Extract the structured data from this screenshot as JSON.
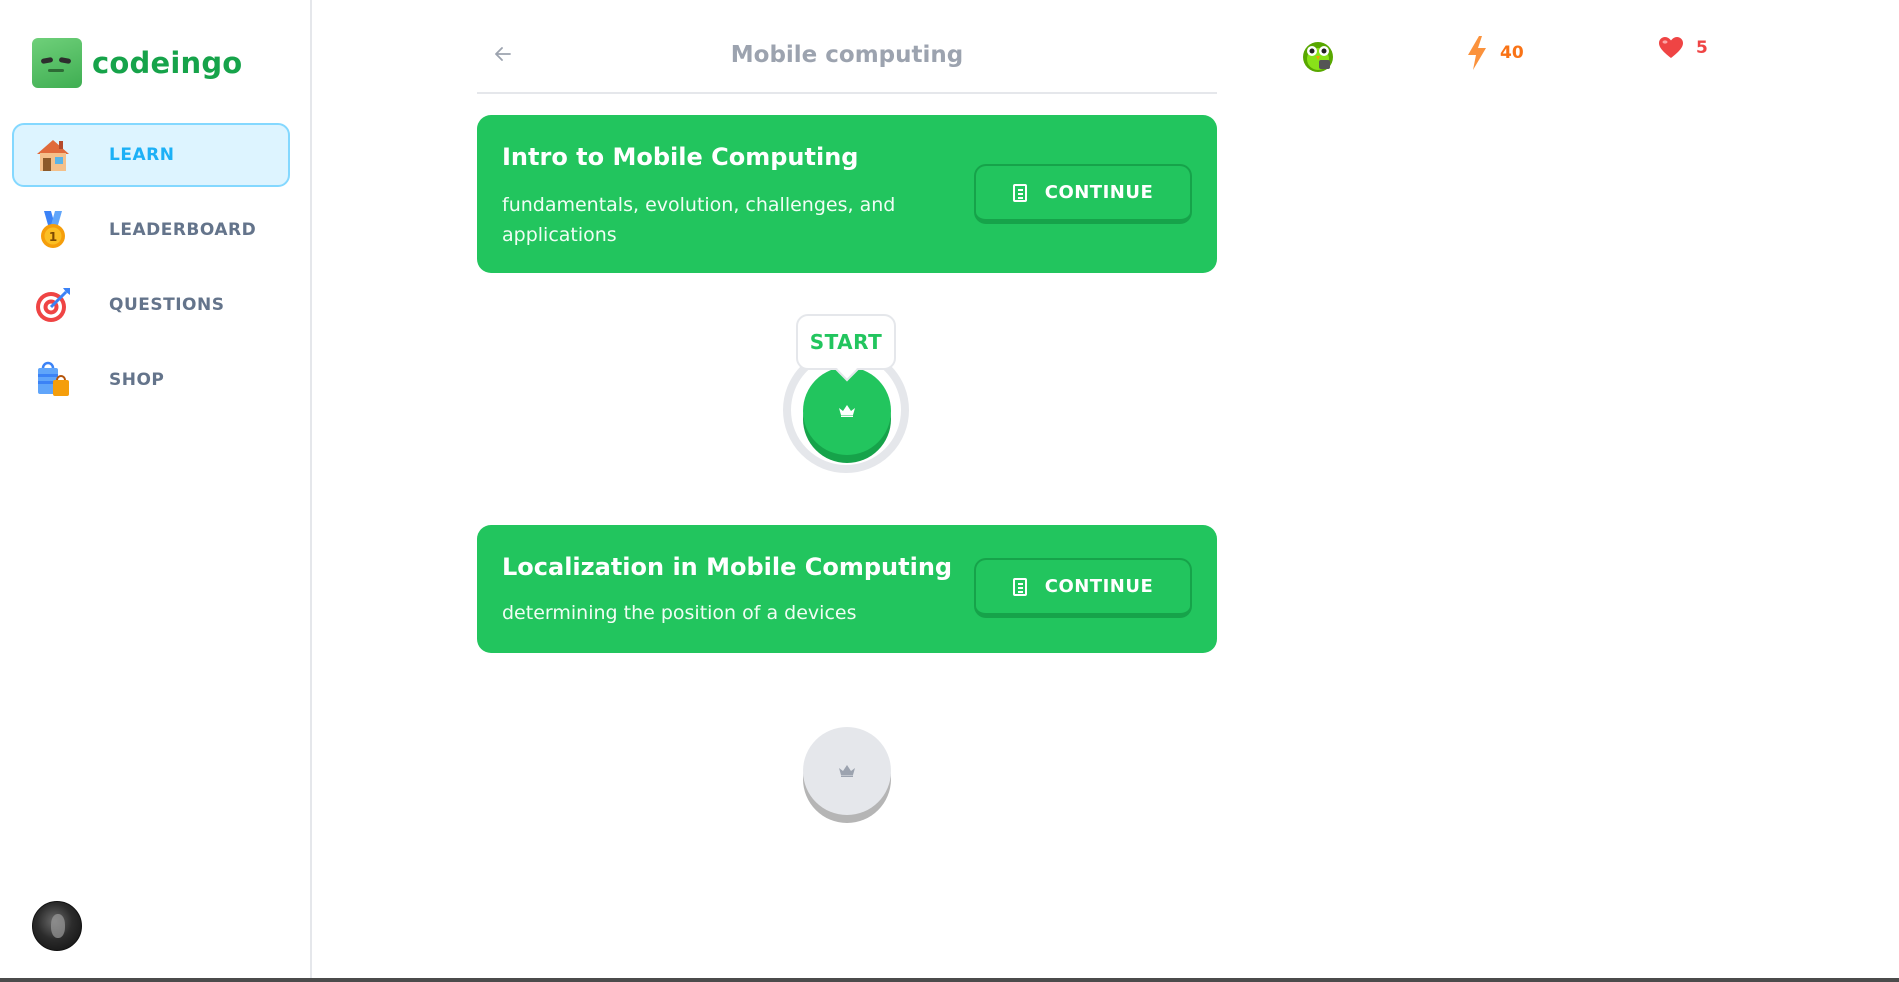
{
  "app": {
    "name": "codeingo"
  },
  "sidebar": {
    "items": [
      {
        "label": "LEARN",
        "icon": "house-icon",
        "active": true
      },
      {
        "label": "LEADERBOARD",
        "icon": "medal-icon",
        "active": false
      },
      {
        "label": "QUESTIONS",
        "icon": "target-icon",
        "active": false
      },
      {
        "label": "SHOP",
        "icon": "shopping-bags-icon",
        "active": false
      }
    ],
    "avatar": "user-avatar"
  },
  "header": {
    "title": "Mobile computing",
    "back_icon": "arrow-left-icon"
  },
  "stats": {
    "mascot_icon": "owl-icon",
    "streak": "40",
    "streak_icon": "lightning-icon",
    "hearts": "5",
    "hearts_icon": "heart-icon"
  },
  "units": [
    {
      "title": "Intro to Mobile Computing",
      "description": "fundamentals, evolution, challenges, and applications",
      "button_label": "CONTINUE",
      "button_icon": "notebook-icon"
    },
    {
      "title": "Localization in Mobile Computing",
      "description": "determining the position of a devices",
      "button_label": "CONTINUE",
      "button_icon": "notebook-icon"
    }
  ],
  "lesson_path": {
    "start_label": "START",
    "nodes": [
      {
        "state": "active",
        "icon": "crown-icon"
      },
      {
        "state": "locked",
        "icon": "crown-icon"
      }
    ]
  },
  "colors": {
    "brand_green": "#22c55e",
    "brand_green_dark": "#16a34a",
    "active_nav_bg": "#ddf4ff",
    "active_nav_text": "#1cb0f6",
    "streak": "#f97316",
    "hearts": "#ef4444"
  }
}
